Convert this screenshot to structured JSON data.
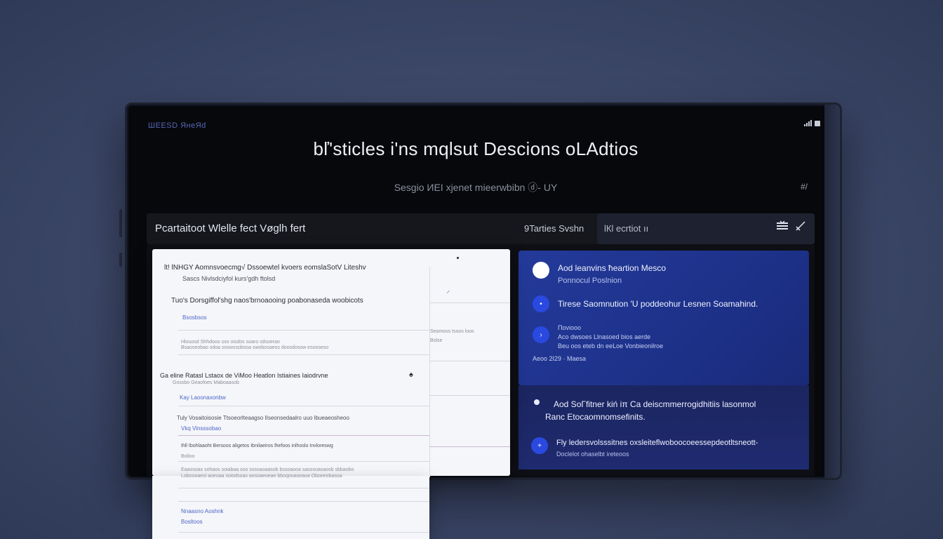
{
  "status_bar": {
    "left_text": "ШЕЕSD ЯнеЯd",
    "icon": "signal-battery-icon"
  },
  "header": {
    "title": "bľ'sticles i'ns mqlsut Descions oLAdtios",
    "subtitle": "Sesgio ИEI xjenet mieerwbibn ⓓ- UY",
    "corner_glyph": "#/"
  },
  "toolbar": {
    "left_label": "Pcartaitoot Wlelle fect Vøglh fert",
    "mid_label": "9Tarties Svshn",
    "right_label": "lКl ecrtiot ıı",
    "icons": [
      "menu-lines-icon",
      "close-slash-icon"
    ]
  },
  "blue_panel": {
    "items": [
      {
        "title": "Aod leanvins ħeaɾtion Mesco",
        "sub": "Ponnocul Poslnion"
      },
      {
        "title": "Tirese Saomnution 'U poddeohur Lesnen Soamahind."
      },
      {
        "title": "Пoviooo",
        "sub": "Aco dwsoes Llnasoed bios aerde",
        "sub2": "Beu oos eteb dn eeLoe Vonbieonilroe"
      },
      {
        "title": "Aeoo  2I29 · Maesa"
      }
    ],
    "lower": [
      {
        "title": "Aod SoΓfitner kiń iπ  Ca deiscmmerrogidhitiis lasonmol"
      },
      {
        "title": "Ranc Etocaomnomsefinits."
      },
      {
        "title": "Fly ledersvolsssitnes oxsleiteflwoboocoeessepdeotltsneott-",
        "sub": "Doclelot ohaselbt iɾeteoos"
      }
    ]
  },
  "doc": {
    "lines": [
      {
        "text": "lt! lNHGY Aomnsvoecmg√ Dssoewtel kvoers eomslaSotV Liteshv",
        "kind": "head"
      },
      {
        "text": "Sascs Nivlsdciyfol kurs'gdh ftolsd",
        "kind": "mid"
      },
      {
        "text": "Tuo's Dorsgiffol'shg naos'brnoaooing poabonaseda woobicots",
        "kind": "head"
      },
      {
        "text": "Bsosbsos",
        "kind": "link"
      },
      {
        "text": "Hlouosd  Shhdooo sxo oisdos soaro sdsoerao",
        "kind": "dim"
      },
      {
        "text": "Bsaoseobao sdoa soswssobsoa swobosaeos doosdosow esooseso",
        "kind": "dim"
      },
      {
        "text": "Ga eline Ratasl Lstaox de ViMoo Heatlon Istiaines Iaiodrvne",
        "kind": "head"
      },
      {
        "text": "Gossbo Geaofoes Maboaasob",
        "kind": "dim"
      },
      {
        "text": "Kay Laoonaxonbw",
        "kind": "link"
      },
      {
        "text": "Tuly Vosaitoisosie Ttsoeorlteaagso IIseonsedaalro uuo lbueaeosheoo",
        "kind": "mid"
      },
      {
        "text": "Vkq Vinsssobao",
        "kind": "link"
      },
      {
        "text": "Ihll Ibohlaaoht Bersoos aligetos Ibnilaeiros lhefoos inlhoslo Invloreswg",
        "kind": "mid"
      },
      {
        "text": "Bolioo",
        "kind": "dim"
      },
      {
        "text": "Eaaosoas sohaos soiabaa soo sssoaoaasob  bssoaooa  sasosoasaosb  sbbaobo",
        "kind": "dim"
      },
      {
        "text": "Loboooaesi aoeoaa  soiodsoas aosoaeoeae  bboqooaseaoa  Oboeeobasoa",
        "kind": "dim"
      },
      {
        "text": "Nnaasno Aoshnk",
        "kind": "link"
      },
      {
        "text": "Bosltoos",
        "kind": "link"
      }
    ],
    "side_notes": [
      "Seamoss tsoos loos",
      "Bolse"
    ],
    "glyph": "♠"
  },
  "colors": {
    "accent": "#2a49e0",
    "panel": "#1f3490",
    "screen": "#07080b"
  }
}
